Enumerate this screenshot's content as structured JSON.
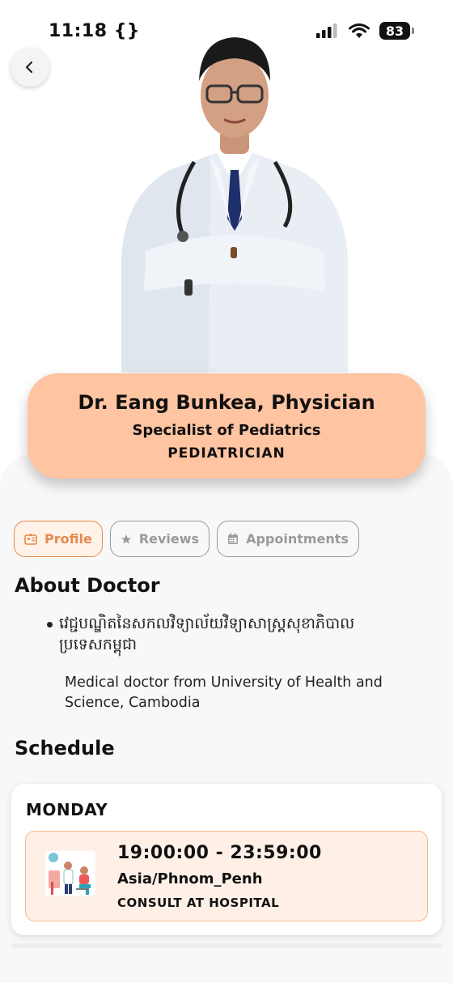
{
  "status_bar": {
    "time": "11:18",
    "time_extra": "{}",
    "battery": "83"
  },
  "doctor": {
    "name": "Dr. Eang Bunkea, Physician",
    "specialty": "Specialist of Pediatrics",
    "title": "PEDIATRICIAN"
  },
  "tabs": [
    {
      "label": "Profile",
      "icon": "id-card-icon",
      "active": true
    },
    {
      "label": "Reviews",
      "icon": "star-icon",
      "active": false
    },
    {
      "label": "Appointments",
      "icon": "calendar-icon",
      "active": false
    }
  ],
  "about": {
    "title": "About Doctor",
    "bullet_km": "វេជ្ជបណ្ឌិតនៃសកលវិទ្យាល័យវិទ្យាសាស្ត្រសុខាភិបាល ប្រទេសកម្ពុជា",
    "bullet_en": "Medical doctor from University of Health and Science, Cambodia"
  },
  "schedule": {
    "title": "Schedule",
    "day": "MONDAY",
    "time_range": "19:00:00 - 23:59:00",
    "timezone": "Asia/Phnom_Penh",
    "consult_type": "CONSULT AT HOSPITAL"
  },
  "colors": {
    "accent": "#e58a4e",
    "card_bg": "#ffc4a1",
    "slot_bg": "#fff0e7"
  }
}
